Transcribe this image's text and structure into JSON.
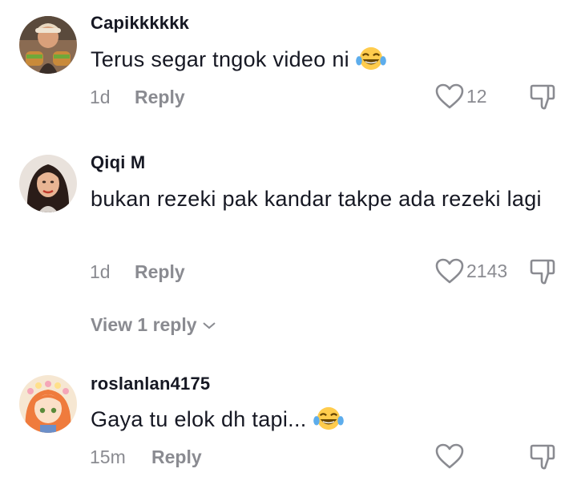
{
  "comments": [
    {
      "username": "Capikkkkkk",
      "text": "Terus segar tngok video ni",
      "has_emoji": true,
      "time": "1d",
      "reply_label": "Reply",
      "likes": "12",
      "avatar_icon": "user-photo-man-holding-food"
    },
    {
      "username": "Qiqi M",
      "text": "bukan rezeki pak kandar takpe ada rezeki lagi",
      "has_emoji": false,
      "time": "1d",
      "reply_label": "Reply",
      "likes": "2143",
      "avatar_icon": "user-photo-woman"
    },
    {
      "username": "roslanlan4175",
      "text": "Gaya tu elok dh tapi...",
      "has_emoji": true,
      "time": "15m",
      "reply_label": "Reply",
      "likes": "",
      "avatar_icon": "anime-girl-flower-crown"
    }
  ],
  "view_replies": "View 1 reply",
  "colors": {
    "text": "#161823",
    "muted": "#8a8b91",
    "background": "#ffffff"
  }
}
